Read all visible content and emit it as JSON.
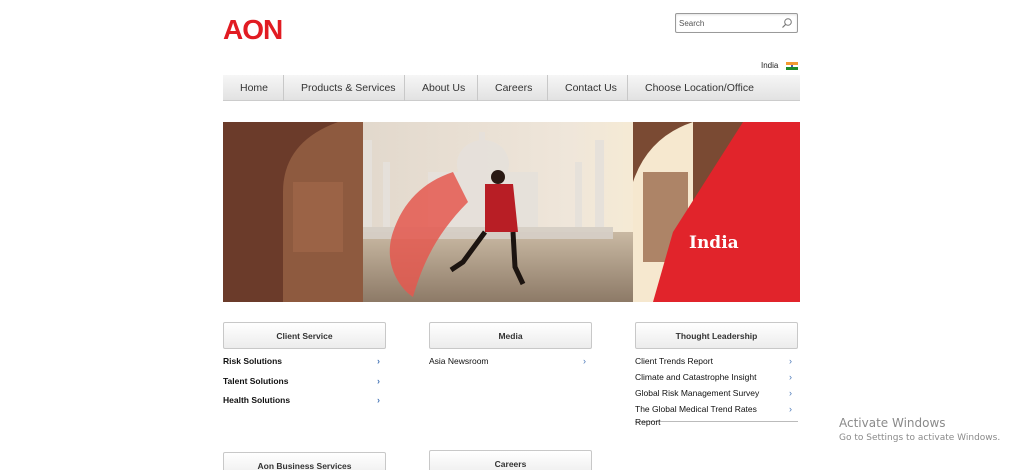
{
  "brand": {
    "logo_text": "AON",
    "accent_color": "#e11b22"
  },
  "search": {
    "placeholder": "Search",
    "value": ""
  },
  "locale": {
    "country": "India",
    "flag_icon": "india-flag-icon"
  },
  "nav": {
    "items": [
      {
        "label": "Home"
      },
      {
        "label": "Products & Services"
      },
      {
        "label": "About Us"
      },
      {
        "label": "Careers"
      },
      {
        "label": "Contact Us"
      },
      {
        "label": "Choose Location/Office"
      }
    ]
  },
  "hero": {
    "title": "India"
  },
  "client_service": {
    "header": "Client Service",
    "items": [
      {
        "label": "Risk Solutions"
      },
      {
        "label": "Talent Solutions"
      },
      {
        "label": "Health Solutions"
      }
    ]
  },
  "media": {
    "header": "Media",
    "items": [
      {
        "label": "Asia Newsroom"
      }
    ]
  },
  "thought_leadership": {
    "header": "Thought Leadership",
    "items": [
      {
        "label": "Client Trends Report"
      },
      {
        "label": "Climate and Catastrophe Insight"
      },
      {
        "label": "Global Risk Management Survey"
      },
      {
        "label": "The Global Medical Trend Rates Report"
      }
    ]
  },
  "aon_business_services": {
    "header": "Aon Business Services"
  },
  "careers_box": {
    "header": "Careers"
  },
  "watermark": {
    "title": "Activate Windows",
    "subtitle": "Go to Settings to activate Windows."
  },
  "chevron_glyph": "›"
}
